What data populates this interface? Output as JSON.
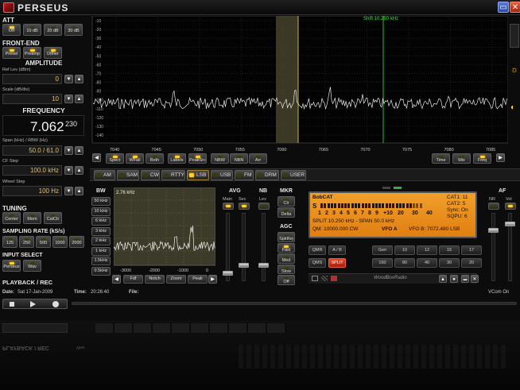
{
  "app": {
    "title": "PERSEUS",
    "accent": "#ffd030",
    "lcd_color": "#f0a02a"
  },
  "window_icons": [
    "minimize-icon",
    "close-icon"
  ],
  "att": {
    "title": "ATT",
    "buttons": [
      {
        "label": "Off",
        "on": true
      },
      {
        "label": "10 dB",
        "on": false
      },
      {
        "label": "20 dB",
        "on": false
      },
      {
        "label": "30 dB",
        "on": false
      }
    ]
  },
  "frontend": {
    "title": "FRONT-END",
    "buttons": [
      {
        "label": "Presel",
        "on": true
      },
      {
        "label": "Preamp",
        "on": true
      },
      {
        "label": "Dither",
        "on": true
      }
    ]
  },
  "amplitude": {
    "title": "AMPLITUDE",
    "ref_label": "Ref Lev (dBm)",
    "ref_value": "0",
    "scale_label": "Scale (dB/div)",
    "scale_value": "10"
  },
  "frequency": {
    "title": "FREQUENCY",
    "mhz": "7.062",
    "hz": "230",
    "span_label": "Span (kHz) / RBW (Hz)",
    "span_value": "50.0 / 61.0",
    "cfstep_label": "CF Step",
    "cfstep_value": "100.0 kHz",
    "wheel_label": "Wheel Step",
    "wheel_value": "100 Hz"
  },
  "tuning": {
    "title": "TUNING",
    "buttons": [
      {
        "label": "Center"
      },
      {
        "label": "Mem"
      },
      {
        "label": "CalCtr"
      }
    ]
  },
  "sampling": {
    "title": "SAMPLING RATE (kS/s)",
    "buttons": [
      {
        "label": "125",
        "on": false
      },
      {
        "label": "250",
        "on": false
      },
      {
        "label": "500",
        "on": false
      },
      {
        "label": "1000",
        "on": false
      },
      {
        "label": "2000",
        "on": false
      }
    ]
  },
  "input": {
    "title": "INPUT SELECT",
    "buttons": [
      {
        "label": "Perseus",
        "on": true
      },
      {
        "label": "Wav",
        "on": false
      }
    ]
  },
  "playback": {
    "title": "PLAYBACK / REC",
    "date_label": "Date:",
    "date_value": "Sat 17-Jan-2009",
    "time_label": "Time:",
    "time_value": "20:26:40",
    "file_label": "File:",
    "vcom": "VCom On",
    "buttons": [
      "stop-icon",
      "play-icon",
      "record-icon"
    ],
    "reflection_title": "PLAYBACK / REC",
    "reflection_wav": "Wav"
  },
  "spectrum": {
    "shift_label": "Shift 10.250 kHz",
    "y_ticks": [
      "-10",
      "-20",
      "-30",
      "-40",
      "-50",
      "-60",
      "-70",
      "-80",
      "-90",
      "-100",
      "-110",
      "-120",
      "-130",
      "-140"
    ],
    "x_ticks": [
      "7040",
      "7045",
      "7050",
      "7055",
      "7060",
      "7065",
      "7070",
      "7075",
      "7080",
      "7085"
    ],
    "buttons": [
      "Spect",
      "WFall",
      "Both",
      "Labels",
      "PeakSrc",
      "NBW",
      "NBN",
      "Arr"
    ],
    "right_buttons": [
      "Time",
      "Mix",
      "Freq"
    ]
  },
  "modes": [
    {
      "label": "AM",
      "on": false
    },
    {
      "label": "SAM",
      "on": false
    },
    {
      "label": "CW",
      "on": false
    },
    {
      "label": "RTTY",
      "on": false
    },
    {
      "label": "LSB",
      "on": true
    },
    {
      "label": "USB",
      "on": false
    },
    {
      "label": "FM",
      "on": false
    },
    {
      "label": "DRM",
      "on": false
    },
    {
      "label": "USER",
      "on": false
    }
  ],
  "filter": {
    "title": "BW",
    "bw_value": "2.76 kHz",
    "bw_buttons": [
      "50 kHz",
      "10 kHz",
      "6 kHz",
      "3 kHz",
      "2 kHz",
      "1 kHz",
      "1.5kHz",
      "0.5kHz"
    ],
    "x_ticks": [
      "-3000",
      "-2000",
      "-1000",
      "0"
    ],
    "buttons": [
      "Fdf",
      "Notch",
      "Zoom",
      "Peak"
    ]
  },
  "avg": {
    "title": "AVG",
    "main": "Main",
    "sec": "Sec"
  },
  "nb": {
    "title": "NB",
    "lev": "Lev"
  },
  "mkr": {
    "title": "MKR",
    "buttons": [
      "Clr",
      "Delta"
    ]
  },
  "agc": {
    "title": "AGC",
    "buttons": [
      "SpkRej",
      "Fast",
      "Med",
      "Slow",
      "Off"
    ]
  },
  "lcd": {
    "name": "BobCAT",
    "s_label": "S",
    "s_scale": [
      "1",
      "2",
      "3",
      "4",
      "5",
      "6",
      "7",
      "8",
      "9",
      "+10",
      "20",
      "30",
      "40"
    ],
    "split_line": "SPLIT  10.250 kHz - SPAN 50.0 kHz",
    "qm_line": "QM: 10000.000 CW",
    "vfo_a": "VFO A",
    "vfo_b": "VFO B: 7072.480 LSB",
    "cat1": "CAT1: 11",
    "cat2": "CAT2: 5",
    "sync": "Sync: On",
    "sqpu": "SQPU: 6"
  },
  "radio": {
    "buttons": [
      "QMR",
      "A / B",
      "QMS",
      "SPLIT"
    ],
    "grid": [
      "Gen",
      "10",
      "12",
      "15",
      "17",
      "160",
      "80",
      "40",
      "30",
      "20"
    ],
    "brand": "WoodBoxRadio"
  },
  "af": {
    "title": "AF",
    "nr": "NR",
    "vol": "Vol"
  }
}
